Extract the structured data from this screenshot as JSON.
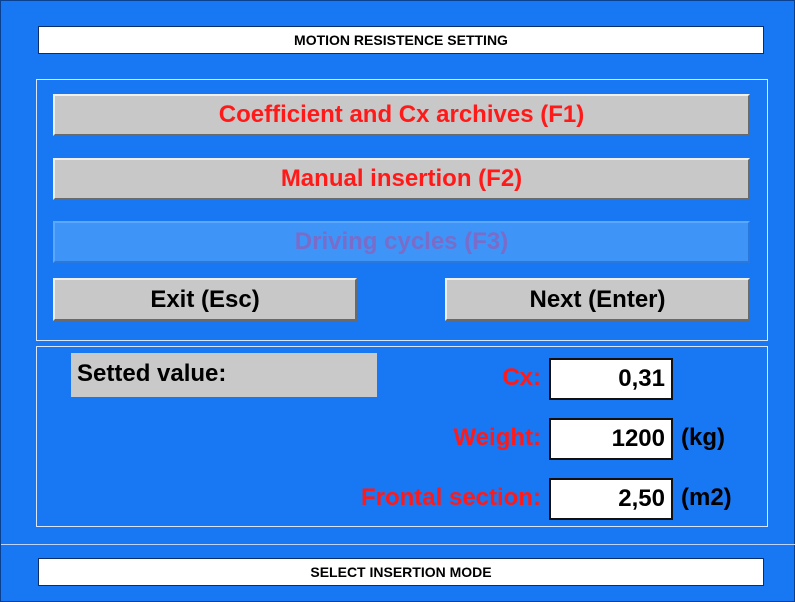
{
  "window": {
    "title": "MOTION RESISTENCE SETTING",
    "status": "SELECT INSERTION MODE"
  },
  "buttons": {
    "coefficient_archives": "Coefficient and Cx archives (F1)",
    "manual_insertion": "Manual insertion (F2)",
    "driving_cycles": "Driving cycles (F3)",
    "exit": "Exit (Esc)",
    "next": "Next (Enter)"
  },
  "values": {
    "setted_label": "Setted value:",
    "cx_label": "Cx:",
    "cx_value": "0,31",
    "weight_label": "Weight:",
    "weight_value": "1200",
    "weight_unit": "(kg)",
    "frontal_label": "Frontal section:",
    "frontal_value": "2,50",
    "frontal_unit": "(m2)"
  },
  "colors": {
    "background": "#1877f2",
    "button_face": "#c8c8c8",
    "accent_text": "#ff1a1a",
    "disabled_button": "#3f94f8",
    "disabled_text": "#7a6cc9"
  }
}
